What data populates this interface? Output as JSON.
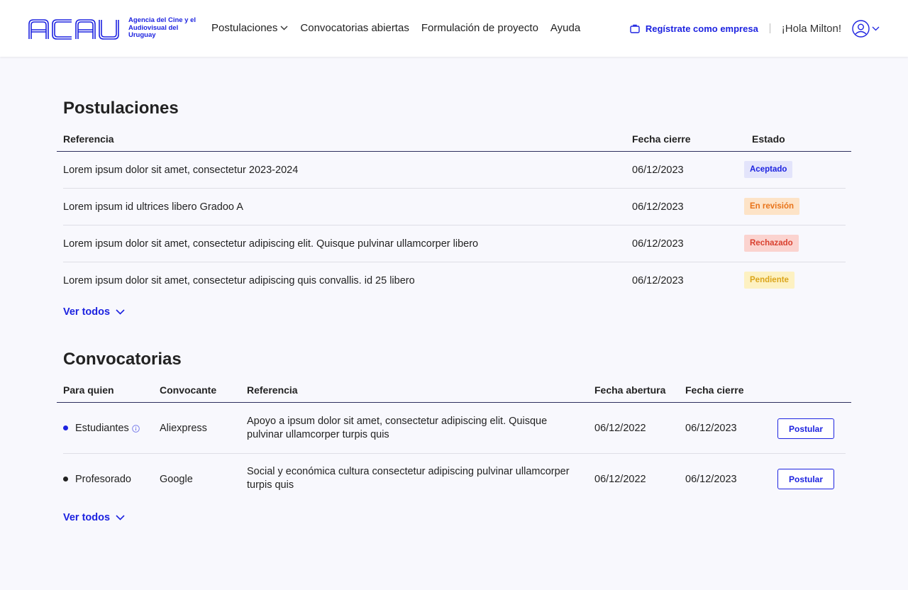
{
  "brand": {
    "logo_text": "ACAU",
    "tagline": "Agencia del Cine y el Audiovisual del Uruguay",
    "accent": "#1d23e0"
  },
  "nav": {
    "items": [
      "Postulaciones",
      "Convocatorias abiertas",
      "Formulación de proyecto",
      "Ayuda"
    ]
  },
  "header_right": {
    "register_label": "Regístrate como empresa",
    "greeting": "¡Hola Milton!"
  },
  "postulaciones": {
    "title": "Postulaciones",
    "columns": [
      "Referencia",
      "Fecha cierre",
      "Estado"
    ],
    "rows": [
      {
        "ref": "Lorem ipsum dolor sit amet, consectetur 2023-2024",
        "date": "06/12/2023",
        "status": "Aceptado"
      },
      {
        "ref": "Lorem ipsum  id ultrices libero Gradoo A",
        "date": "06/12/2023",
        "status": "En revisión"
      },
      {
        "ref": "Lorem ipsum dolor sit amet, consectetur adipiscing elit. Quisque pulvinar ullamcorper libero",
        "date": "06/12/2023",
        "status": "Rechazado"
      },
      {
        "ref": "Lorem ipsum dolor sit amet, consectetur adipiscing  quis convallis. id 25 libero",
        "date": "06/12/2023",
        "status": "Pendiente"
      }
    ],
    "see_all": "Ver todos"
  },
  "convocatorias": {
    "title": "Convocatorias",
    "columns": [
      "Para quien",
      "Convocante",
      "Referencia",
      "Fecha abertura",
      "Fecha cierre"
    ],
    "rows": [
      {
        "who": "Estudiantes",
        "by": "Aliexpress",
        "ref": "Apoyo a ipsum dolor sit amet, consectetur adipiscing elit. Quisque pulvinar ullamcorper turpis quis",
        "open": "06/12/2022",
        "close": "06/12/2023",
        "action": "Postular",
        "dot_color": "#1d23e0"
      },
      {
        "who": "Profesorado",
        "by": "Google",
        "ref": "Social y económica cultura consectetur adipiscing pulvinar ullamcorper turpis quis",
        "open": "06/12/2022",
        "close": "06/12/2023",
        "action": "Postular",
        "dot_color": "#222222"
      }
    ],
    "see_all": "Ver todos"
  }
}
